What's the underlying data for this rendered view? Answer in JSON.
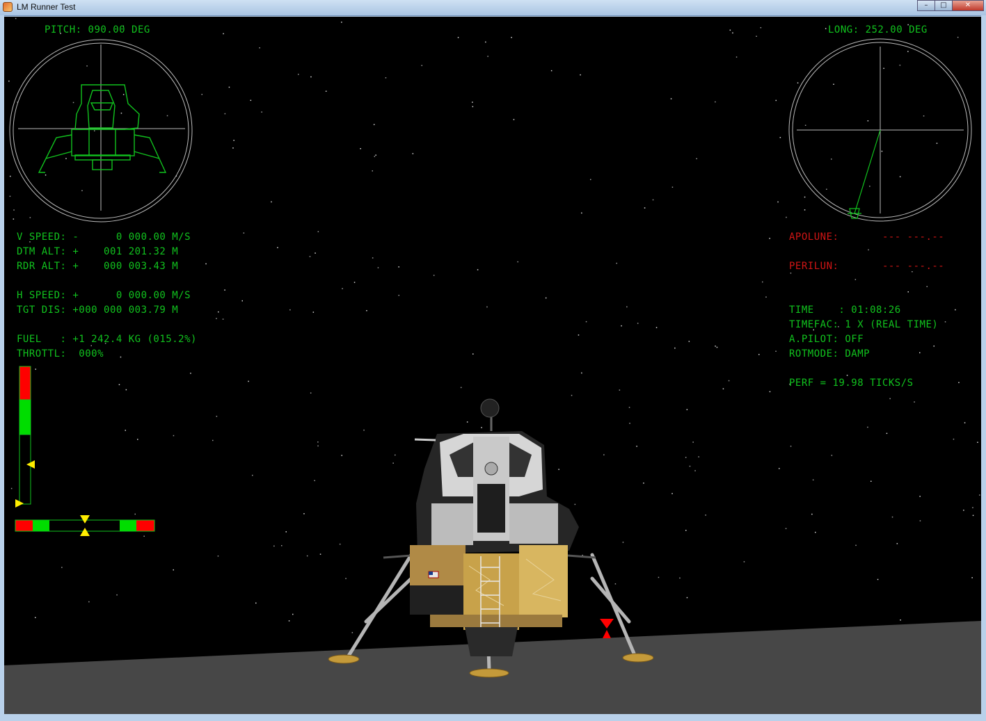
{
  "window": {
    "title": "LM Runner Test"
  },
  "hud_left": {
    "pitch_label": "PITCH",
    "pitch_value": ": 090.00 DEG",
    "v_speed_label": "V SPEED",
    "v_speed_value": ": -      0 000.00 M/S",
    "dtm_alt_label": "DTM ALT",
    "dtm_alt_value": ": +    001 201.32 M",
    "rdr_alt_label": "RDR ALT",
    "rdr_alt_value": ": +    000 003.43 M",
    "h_speed_label": "H SPEED",
    "h_speed_value": ": +      0 000.00 M/S",
    "tgt_dis_label": "TGT DIS",
    "tgt_dis_value": ": +000 000 003.79 M",
    "fuel_label": "FUEL",
    "fuel_value": "   : +1 242.4 KG (015.2%)",
    "throttle_label": "THROTTL",
    "throttle_value": ":  000%"
  },
  "hud_right": {
    "long_label": "LONG",
    "long_value": ": 252.00 DEG",
    "apolune_label": "APOLUNE",
    "apolune_value": ":       --- ---.--",
    "perilune_label": "PERILUN",
    "perilune_value": ":       --- ---.--",
    "time_label": "TIME",
    "time_value": "    : 01:08:26",
    "timefac_label": "TIMEFAC",
    "timefac_value": ": 1 X (REAL TIME)",
    "apilot_label": "A.PILOT",
    "apilot_value": ": OFF",
    "rotmode_label": "ROTMODE",
    "rotmode_value": ": DAMP",
    "perf_label": "PERF",
    "perf_value": " = 19.98 TICKS/S"
  },
  "gauges": {
    "vertical_throttle_level": 0.0,
    "vertical_speed_marker": 0.5,
    "horizontal_speed_marker": 0.5
  },
  "colors": {
    "hud_green": "#11c31e",
    "hud_red": "#d21515",
    "marker_yellow": "#ffee00",
    "ground": "#474747",
    "space": "#000000"
  }
}
